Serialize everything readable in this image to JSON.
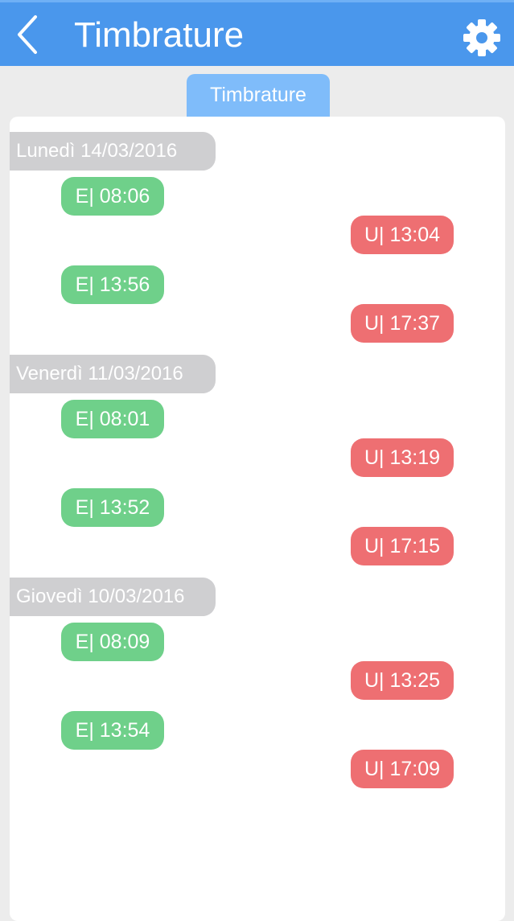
{
  "header": {
    "title": "Timbrature",
    "back_icon": "chevron-left-icon",
    "settings_icon": "gear-icon",
    "color": "#4a97ec"
  },
  "tabs": [
    {
      "label": "Timbrature",
      "active": true
    }
  ],
  "colors": {
    "entry": "#6fd08a",
    "exit": "#ee6f72",
    "day_label": "#cfcfd1",
    "tab_active": "#7fbcfa"
  },
  "days": [
    {
      "label": "Lunedì 14/03/2016",
      "punches": [
        {
          "type": "E",
          "text": "E| 08:06"
        },
        {
          "type": "U",
          "text": "U| 13:04"
        },
        {
          "type": "E",
          "text": "E| 13:56"
        },
        {
          "type": "U",
          "text": "U| 17:37"
        }
      ]
    },
    {
      "label": "Venerdì 11/03/2016",
      "punches": [
        {
          "type": "E",
          "text": "E| 08:01"
        },
        {
          "type": "U",
          "text": "U| 13:19"
        },
        {
          "type": "E",
          "text": "E| 13:52"
        },
        {
          "type": "U",
          "text": "U| 17:15"
        }
      ]
    },
    {
      "label": "Giovedì 10/03/2016",
      "punches": [
        {
          "type": "E",
          "text": "E| 08:09"
        },
        {
          "type": "U",
          "text": "U| 13:25"
        },
        {
          "type": "E",
          "text": "E| 13:54"
        },
        {
          "type": "U",
          "text": "U| 17:09"
        }
      ]
    }
  ]
}
